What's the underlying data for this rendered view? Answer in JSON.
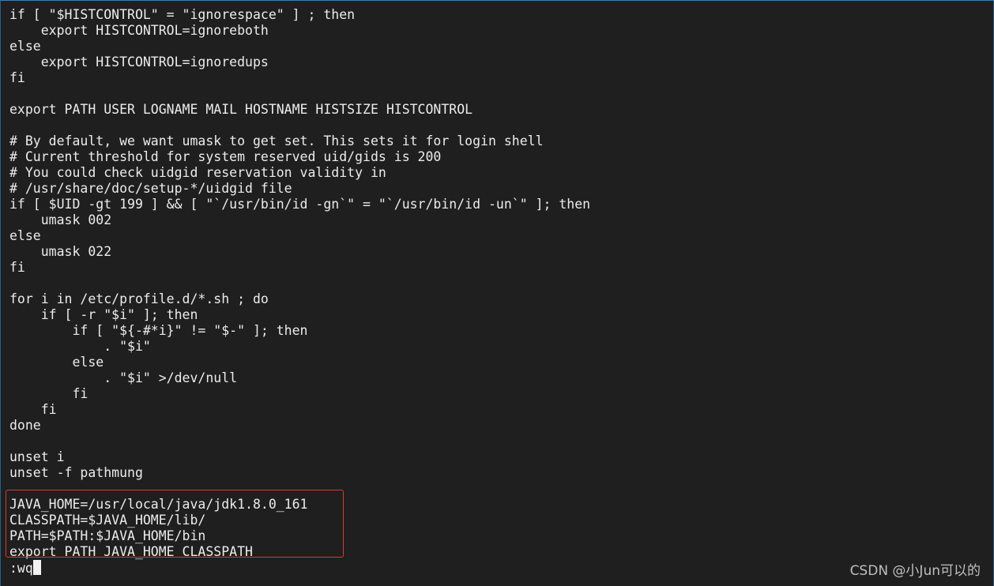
{
  "terminal": {
    "lines": [
      "if [ \"$HISTCONTROL\" = \"ignorespace\" ] ; then",
      "    export HISTCONTROL=ignoreboth",
      "else",
      "    export HISTCONTROL=ignoredups",
      "fi",
      "",
      "export PATH USER LOGNAME MAIL HOSTNAME HISTSIZE HISTCONTROL",
      "",
      "# By default, we want umask to get set. This sets it for login shell",
      "# Current threshold for system reserved uid/gids is 200",
      "# You could check uidgid reservation validity in",
      "# /usr/share/doc/setup-*/uidgid file",
      "if [ $UID -gt 199 ] && [ \"`/usr/bin/id -gn`\" = \"`/usr/bin/id -un`\" ]; then",
      "    umask 002",
      "else",
      "    umask 022",
      "fi",
      "",
      "for i in /etc/profile.d/*.sh ; do",
      "    if [ -r \"$i\" ]; then",
      "        if [ \"${-#*i}\" != \"$-\" ]; then",
      "            . \"$i\"",
      "        else",
      "            . \"$i\" >/dev/null",
      "        fi",
      "    fi",
      "done",
      "",
      "unset i",
      "unset -f pathmung",
      "",
      "JAVA_HOME=/usr/local/java/jdk1.8.0_161",
      "CLASSPATH=$JAVA_HOME/lib/",
      "PATH=$PATH:$JAVA_HOME/bin",
      "export PATH JAVA_HOME CLASSPATH"
    ],
    "command_line": ":wq"
  },
  "watermark": "CSDN @小Jun可以的",
  "colors": {
    "background": "#1f1f1f",
    "text": "#ececec",
    "highlight_border": "#d63b36",
    "cursor": "#f2f2f2"
  }
}
